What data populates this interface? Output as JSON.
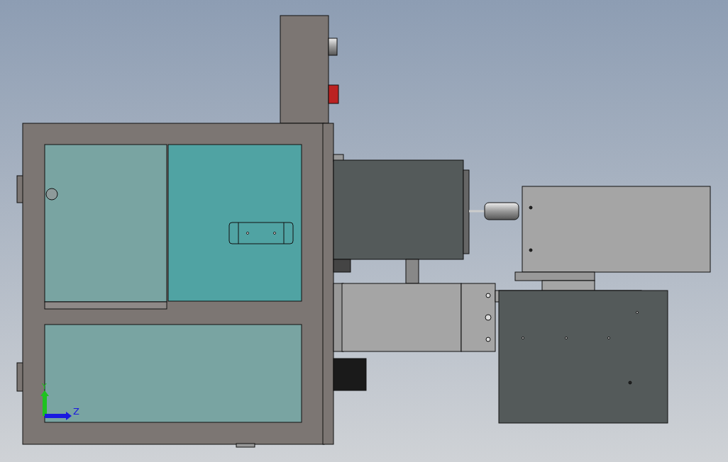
{
  "viewport": {
    "triad": {
      "axes": [
        {
          "label": "Y",
          "color": "#1fc21f",
          "kind": "vertical"
        },
        {
          "label": "Z",
          "color": "#1a1ae0",
          "kind": "horizontal"
        }
      ]
    }
  }
}
